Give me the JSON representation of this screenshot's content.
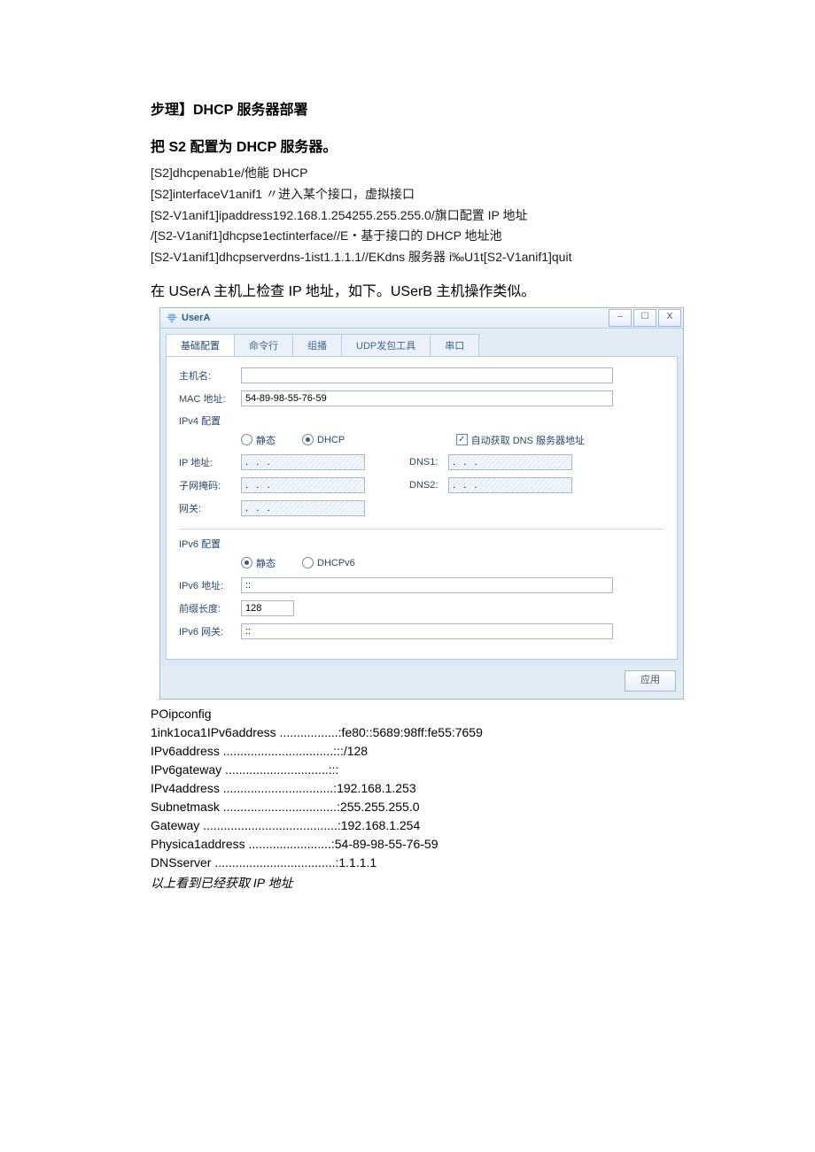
{
  "headings": {
    "step_title": "步理】DHCP 服务器部署",
    "config_intro": "把 S2 配置为 DHCP 服务器。",
    "check_intro": "在 USerA 主机上检查 IP 地址，如下。USerB 主机操作类似。"
  },
  "cli": {
    "l1": "[S2]dhcpenab1e/他能 DHCP",
    "l2": "[S2]interfaceV1anif1 〃进入某个接口，虚拟接口",
    "l3": "[S2-V1anif1]ipaddress192.168.1.254255.255.255.0/旗口配置 IP 地址",
    "l4": "/[S2-V1anif1]dhcpse1ectinterface//E・基于接口的 DHCP 地址池",
    "l5": "[S2-V1anif1]dhcpserverdns-1ist1.1.1.1//EKdns 服务器 i‰U1t[S2-V1anif1]quit"
  },
  "window": {
    "title": "UserA",
    "btn_min": "–",
    "btn_max": "☐",
    "btn_close": "X",
    "tabs": {
      "basic": "基础配置",
      "cmd": "命令行",
      "mcast": "组播",
      "udp": "UDP发包工具",
      "serial": "串口"
    },
    "labels": {
      "hostname": "主机名:",
      "mac": "MAC 地址:",
      "ipv4_section": "IPv4 配置",
      "static": "静态",
      "dhcp": "DHCP",
      "auto_dns": "自动获取 DNS 服务器地址",
      "ip": "IP 地址:",
      "mask": "子网掩码:",
      "gw": "网关:",
      "dns1": "DNS1:",
      "dns2": "DNS2:",
      "ipv6_section": "IPv6 配置",
      "static6": "静态",
      "dhcpv6": "DHCPv6",
      "ipv6addr": "IPv6 地址:",
      "prefix": "前缀长度:",
      "ipv6gw": "IPv6 网关:",
      "apply": "应用"
    },
    "values": {
      "hostname": "",
      "mac": "54-89-98-55-76-59",
      "ip": ".   .   .",
      "mask": ".   .   .",
      "gw": ".   .   .",
      "dns1": ".   .   .",
      "dns2": ".   .   .",
      "ipv6addr": "::",
      "prefix": "128",
      "ipv6gw": "::"
    }
  },
  "console": {
    "l0": "POipconfig",
    "l1": "1ink1oca1IPv6address .................:fe80::5689:98ff:fe55:7659",
    "l2": "IPv6address ................................:::/128",
    "l3": "IPv6gateway ..............................:::",
    "l4": "IPv4address ................................:192.168.1.253",
    "l5": "Subnetmask .................................:255.255.255.0",
    "l6": "Gateway .......................................:192.168.1.254",
    "l7": "Physica1address ........................:54-89-98-55-76-59",
    "l8": "DNSserver ...................................:1.1.1.1",
    "note": "以上看到已经获取 IP 地址"
  }
}
